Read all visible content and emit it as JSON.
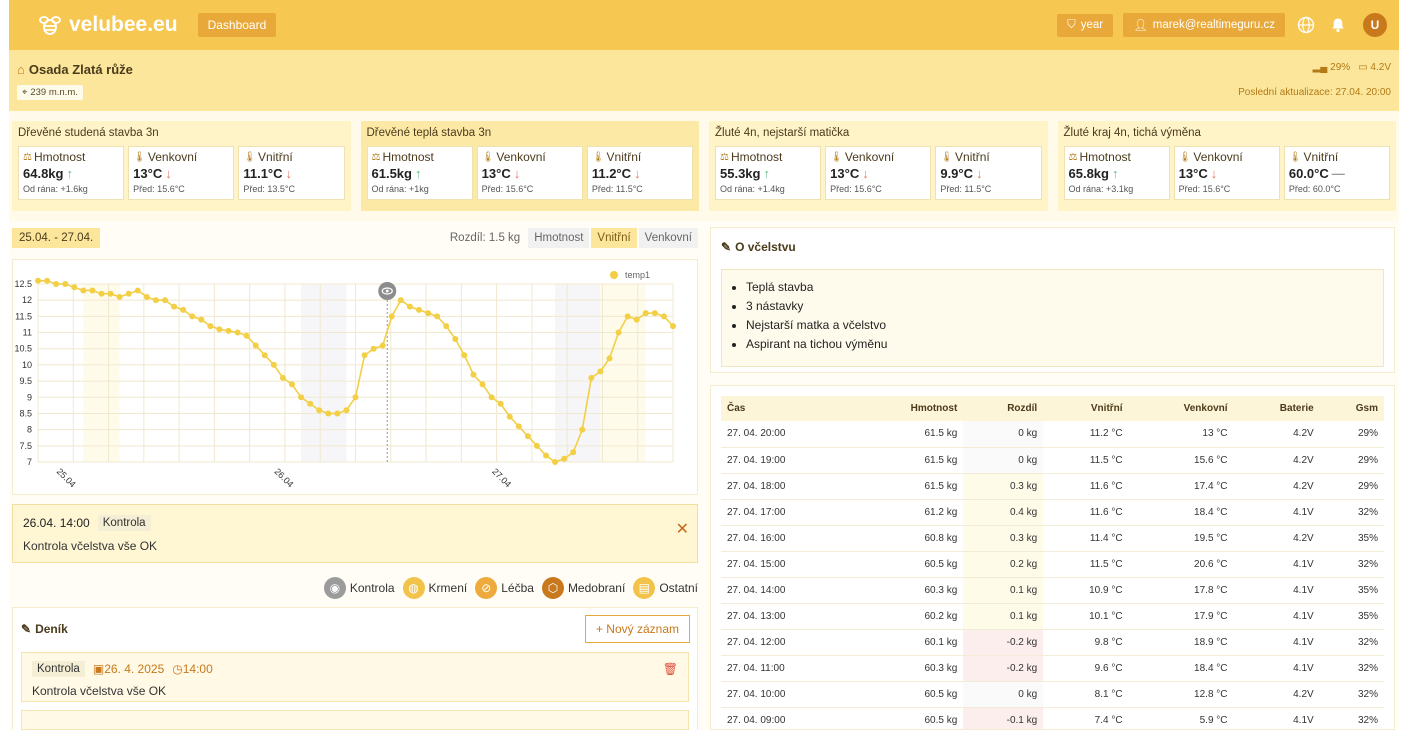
{
  "header": {
    "brand": "velubee.eu",
    "dashboard_label": "Dashboard",
    "period_label": "year",
    "user_email": "marek@realtimeguru.cz",
    "avatar_initial": "U"
  },
  "site": {
    "name": "Osada Zlatá růže",
    "altitude": "239 m.n.m.",
    "signal": "29%",
    "battery": "4.2V",
    "last_update": "Poslední aktualizace: 27.04. 20:00"
  },
  "hives": [
    {
      "name": "Dřevěné studená stavba 3n",
      "selected": false,
      "metrics": [
        {
          "label": "Hmotnost",
          "value": "64.8kg",
          "trend": "up",
          "sub": "Od rána: +1.6kg"
        },
        {
          "label": "Venkovní",
          "value": "13°C",
          "trend": "down",
          "sub": "Před: 15.6°C"
        },
        {
          "label": "Vnitřní",
          "value": "11.1°C",
          "trend": "down",
          "sub": "Před: 13.5°C"
        }
      ]
    },
    {
      "name": "Dřevěné teplá stavba 3n",
      "selected": true,
      "metrics": [
        {
          "label": "Hmotnost",
          "value": "61.5kg",
          "trend": "up",
          "sub": "Od rána: +1kg"
        },
        {
          "label": "Venkovní",
          "value": "13°C",
          "trend": "down",
          "sub": "Před: 15.6°C"
        },
        {
          "label": "Vnitřní",
          "value": "11.2°C",
          "trend": "down",
          "sub": "Před: 11.5°C"
        }
      ]
    },
    {
      "name": "Žluté 4n, nejstarší matička",
      "selected": false,
      "metrics": [
        {
          "label": "Hmotnost",
          "value": "55.3kg",
          "trend": "up",
          "sub": "Od rána: +1.4kg"
        },
        {
          "label": "Venkovní",
          "value": "13°C",
          "trend": "down",
          "sub": "Před: 15.6°C"
        },
        {
          "label": "Vnitřní",
          "value": "9.9°C",
          "trend": "down",
          "sub": "Před: 11.5°C"
        }
      ]
    },
    {
      "name": "Žluté kraj 4n, tichá výměna",
      "selected": false,
      "metrics": [
        {
          "label": "Hmotnost",
          "value": "65.8kg",
          "trend": "up",
          "sub": "Od rána: +3.1kg"
        },
        {
          "label": "Venkovní",
          "value": "13°C",
          "trend": "down",
          "sub": "Před: 15.6°C"
        },
        {
          "label": "Vnitřní",
          "value": "60.0°C",
          "trend": "flat",
          "sub": "Před: 60.0°C"
        }
      ]
    }
  ],
  "chart_controls": {
    "range": "25.04. - 27.04.",
    "difference": "Rozdíl: 1.5 kg",
    "tabs": [
      "Hmotnost",
      "Vnitřní",
      "Venkovní"
    ],
    "active_tab": "Vnitřní"
  },
  "chart_data": {
    "type": "line",
    "series": [
      {
        "name": "temp1",
        "values": [
          12.6,
          12.6,
          12.5,
          12.5,
          12.4,
          12.3,
          12.3,
          12.2,
          12.2,
          12.1,
          12.2,
          12.3,
          12.1,
          12.0,
          12.0,
          11.8,
          11.7,
          11.5,
          11.4,
          11.2,
          11.1,
          11.05,
          11.0,
          10.9,
          10.6,
          10.3,
          10.0,
          9.6,
          9.4,
          9.0,
          8.8,
          8.6,
          8.5,
          8.5,
          8.6,
          9.0,
          10.3,
          10.5,
          10.6,
          11.5,
          12.0,
          11.8,
          11.7,
          11.6,
          11.5,
          11.2,
          10.8,
          10.3,
          9.7,
          9.4,
          9.0,
          8.8,
          8.4,
          8.1,
          7.8,
          7.5,
          7.2,
          7.0,
          7.1,
          7.3,
          8.0,
          9.6,
          9.8,
          10.2,
          11.0,
          11.5,
          11.4,
          11.6,
          11.6,
          11.5,
          11.2
        ]
      }
    ],
    "y_ticks": [
      "12.5",
      "12",
      "11.5",
      "11",
      "10.5",
      "10",
      "9.5",
      "9",
      "8.5",
      "8",
      "7.5",
      "7"
    ],
    "x_ticks": [
      "25.04",
      "26.04",
      "27.04"
    ],
    "ylim": [
      7,
      12.5
    ],
    "legend": "top-right"
  },
  "selected_note": {
    "datetime": "26.04. 14:00",
    "type": "Kontrola",
    "text": "Kontrola včelstva vše OK"
  },
  "event_legend": [
    "Kontrola",
    "Krmení",
    "Léčba",
    "Medobraní",
    "Ostatní"
  ],
  "diary": {
    "title": "Deník",
    "new_label": "+ Nový záznam",
    "entry": {
      "type": "Kontrola",
      "date": "26. 4. 2025",
      "time": "14:00",
      "text": "Kontrola včelstva vše OK"
    }
  },
  "about": {
    "title": "O včelstvu",
    "items": [
      "Teplá stavba",
      "3 nástavky",
      "Nejstarší matka a včelstvo",
      "Aspirant na tichou výměnu"
    ]
  },
  "table": {
    "headers": [
      "Čas",
      "Hmotnost",
      "Rozdíl",
      "Vnitřní",
      "Venkovní",
      "Baterie",
      "Gsm"
    ],
    "rows": [
      [
        "27. 04. 20:00",
        "61.5 kg",
        "0 kg",
        "11.2 °C",
        "13 °C",
        "4.2V",
        "29%"
      ],
      [
        "27. 04. 19:00",
        "61.5 kg",
        "0 kg",
        "11.5 °C",
        "15.6 °C",
        "4.2V",
        "29%"
      ],
      [
        "27. 04. 18:00",
        "61.5 kg",
        "0.3 kg",
        "11.6 °C",
        "17.4 °C",
        "4.2V",
        "29%"
      ],
      [
        "27. 04. 17:00",
        "61.2 kg",
        "0.4 kg",
        "11.6 °C",
        "18.4 °C",
        "4.1V",
        "32%"
      ],
      [
        "27. 04. 16:00",
        "60.8 kg",
        "0.3 kg",
        "11.4 °C",
        "19.5 °C",
        "4.2V",
        "35%"
      ],
      [
        "27. 04. 15:00",
        "60.5 kg",
        "0.2 kg",
        "11.5 °C",
        "20.6 °C",
        "4.1V",
        "32%"
      ],
      [
        "27. 04. 14:00",
        "60.3 kg",
        "0.1 kg",
        "10.9 °C",
        "17.8 °C",
        "4.1V",
        "35%"
      ],
      [
        "27. 04. 13:00",
        "60.2 kg",
        "0.1 kg",
        "10.1 °C",
        "17.9 °C",
        "4.1V",
        "35%"
      ],
      [
        "27. 04. 12:00",
        "60.1 kg",
        "-0.2 kg",
        "9.8 °C",
        "18.9 °C",
        "4.1V",
        "32%"
      ],
      [
        "27. 04. 11:00",
        "60.3 kg",
        "-0.2 kg",
        "9.6 °C",
        "18.4 °C",
        "4.1V",
        "32%"
      ],
      [
        "27. 04. 10:00",
        "60.5 kg",
        "0 kg",
        "8.1 °C",
        "12.8 °C",
        "4.2V",
        "32%"
      ],
      [
        "27. 04. 09:00",
        "60.5 kg",
        "-0.1 kg",
        "7.4 °C",
        "5.9 °C",
        "4.1V",
        "32%"
      ]
    ]
  },
  "colors": {
    "accent": "#f6c751",
    "accent_dark": "#e9a93a",
    "line": "#f2cf45"
  }
}
